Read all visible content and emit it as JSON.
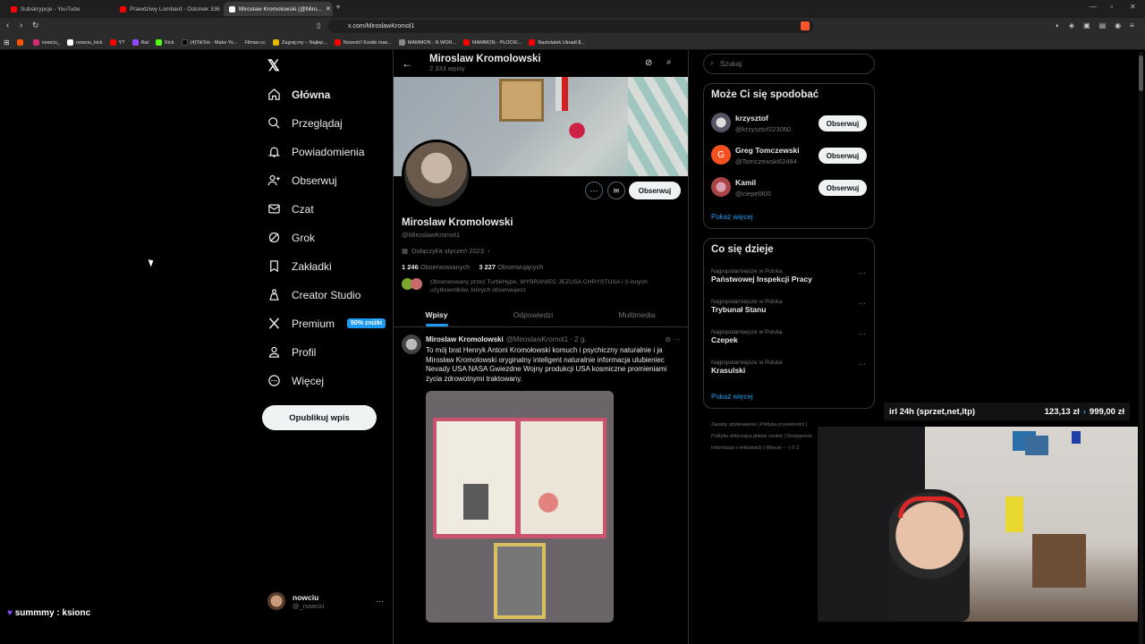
{
  "browser": {
    "tabs": [
      {
        "title": "Subskrypcje - YouTube",
        "color": "#ff0000"
      },
      {
        "title": "Prawdziwy Lombard - Odcinek 336",
        "color": "#ff0000"
      },
      {
        "title": "Miroslaw Kromolowski (@Miro...",
        "color": "#ffffff"
      }
    ],
    "url": "x.com/MiroslawKromol1",
    "bookmarks": [
      "",
      "nowciu_",
      "nowciu_kick",
      "YT",
      "Rat",
      "Kick",
      "(4)TikTok - Make Yo...",
      "Filman.cc",
      "Zagraj.my – Najlep...",
      "Nowość! Kostki mas...",
      "MAMMON - N WOR...",
      "MAMMON - PŁOCKI...",
      "Nastolatek Ukradł $..."
    ]
  },
  "nav": {
    "items": [
      {
        "label": "Główna",
        "icon": "home-icon"
      },
      {
        "label": "Przeglądaj",
        "icon": "search-icon"
      },
      {
        "label": "Powiadomienia",
        "icon": "bell-icon"
      },
      {
        "label": "Obserwuj",
        "icon": "follow-icon"
      },
      {
        "label": "Czat",
        "icon": "mail-icon"
      },
      {
        "label": "Grok",
        "icon": "grok-icon"
      },
      {
        "label": "Zakładki",
        "icon": "bookmark-icon"
      },
      {
        "label": "Creator Studio",
        "icon": "creator-icon"
      },
      {
        "label": "Premium",
        "icon": "x-icon"
      },
      {
        "label": "Profil",
        "icon": "person-icon"
      },
      {
        "label": "Więcej",
        "icon": "more-icon"
      }
    ],
    "premium_badge": "50% zniżki",
    "post_button": "Opublikuj wpis",
    "account": {
      "name": "nowciu",
      "handle": "@_nowciu"
    }
  },
  "profile": {
    "header_name": "Miroslaw Kromolowski",
    "post_count": "2 333 wpisy",
    "name": "Miroslaw Kromolowski",
    "handle": "@MiroslawKromol1",
    "joined": "Dołączył/a styczeń 2023",
    "following_count": "1 246",
    "following_label": "Obserwowanych",
    "followers_count": "3 227",
    "followers_label": "Obserwujących",
    "followed_by": "Obserwowany przez TurtleHype, WYBRANIEC JEZUSA CHRYSTUSA i 3 innych użytkowników, których obserwujesz",
    "follow_button": "Obserwuj",
    "tabs": [
      "Wpisy",
      "Odpowiedzi",
      "Multimedia"
    ]
  },
  "post": {
    "author": "Miroslaw Kromolowski",
    "handle": "@MiroslawKromol1 · 2 g.",
    "text": "To mój brat Henryk Antoni Kromołowski komuch i psychiczny naturalnie i ja Mirosław Kromolowski oryginalny inteligent naturalnie informacja ulubieniec Nevady USA NASA Gwiezdne Wojny produkcji USA kosmiczne promieniami życia zdrowotnymi traktowany."
  },
  "sidebar": {
    "search_placeholder": "Szukaj",
    "who_to_follow_title": "Może Ci się spodobać",
    "suggestions": [
      {
        "name": "krzysztof",
        "handle": "@krzysztof223060",
        "avatar": ""
      },
      {
        "name": "Greg Tomczewski",
        "handle": "@Tomczewski62484",
        "avatar": "G"
      },
      {
        "name": "Kamil",
        "handle": "@ciepel900",
        "avatar": ""
      }
    ],
    "follow_label": "Obserwuj",
    "show_more": "Pokaż więcej",
    "trends_title": "Co się dzieje",
    "trends": [
      {
        "category": "Najpopularniejsze w Polska",
        "name": "Państwowej Inspekcji Pracy"
      },
      {
        "category": "Najpopularniejsze w Polska",
        "name": "Trybunał Stanu"
      },
      {
        "category": "Najpopularniejsze w Polska",
        "name": "Czepek"
      },
      {
        "category": "Najpopularniejsze w Polska",
        "name": "Krasulski"
      }
    ],
    "trends_more": "Pokaż więcej",
    "footer": [
      "Zasady użytkowania",
      "Polityka prywatności",
      "Polityka dotycząca plików cookie",
      "Dostępność",
      "Informacja o reklamach",
      "Więcej ···",
      "© 2"
    ]
  },
  "overlay": {
    "irl_label": "irl 24h (sprzet,net,ltp)",
    "irl_amount": "123,13 zł",
    "irl_goal": "999,00 zł",
    "chat_user": "summmy",
    "chat_message": "ksionc"
  }
}
